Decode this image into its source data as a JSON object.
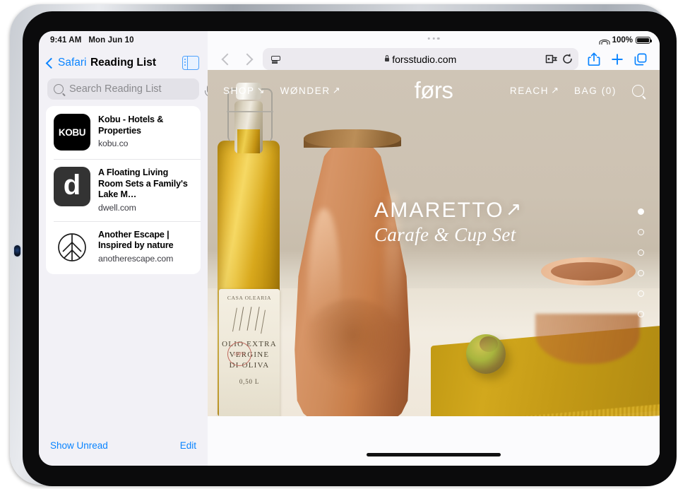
{
  "status_bar": {
    "time": "9:41 AM",
    "date": "Mon Jun 10",
    "battery_percent": "100%",
    "wifi_icon": "wifi-icon",
    "battery_icon": "battery-icon"
  },
  "sidebar": {
    "back_label": "Safari",
    "title": "Reading List",
    "toggle_icon": "sidebar-toggle-icon",
    "search": {
      "placeholder": "Search Reading List",
      "value": "",
      "search_icon": "search-icon",
      "mic_icon": "microphone-icon"
    },
    "items": [
      {
        "title": "Kobu - Hotels & Properties",
        "host": "kobu.co",
        "icon_label": "KOBU",
        "icon_name": "kobu-favicon"
      },
      {
        "title": "A Floating Living Room Sets a Family's Lake M…",
        "host": "dwell.com",
        "icon_label": "d",
        "icon_name": "dwell-favicon"
      },
      {
        "title": "Another Escape | Inspired by nature",
        "host": "anotherescape.com",
        "icon_label": "",
        "icon_name": "leaf-favicon"
      }
    ],
    "footer": {
      "show_unread": "Show Unread",
      "edit": "Edit"
    }
  },
  "browser": {
    "back_icon": "chevron-left-icon",
    "forward_icon": "chevron-forward-icon",
    "page_settings_icon": "page-settings-icon",
    "lock_icon": "lock-icon",
    "url": "forsstudio.com",
    "extensions_icon": "extensions-icon",
    "reload_icon": "reload-icon",
    "share_icon": "share-icon",
    "new_tab_icon": "plus-icon",
    "tabs_icon": "tab-overview-icon",
    "window_dots_icon": "multitask-dots-icon"
  },
  "site": {
    "brand": "førs",
    "nav_left": [
      {
        "label": "SHOP",
        "arrow": "↘"
      },
      {
        "label": "WØNDER",
        "arrow": "↗"
      }
    ],
    "nav_right": [
      {
        "label": "REACH",
        "arrow": "↗"
      },
      {
        "label": "BAG (0)",
        "arrow": ""
      }
    ],
    "search_icon": "search-icon",
    "hero": {
      "title": "AMARETTO",
      "title_arrow": "↗",
      "subtitle": "Carafe & Cup Set"
    },
    "pagination": {
      "total": 6,
      "active_index": 0
    },
    "colors": {
      "accent_blue": "#0a84ff",
      "hero_bg": "#c9bdac",
      "carafe": "#cf8b5a",
      "cloth": "#c59b16"
    }
  },
  "home_indicator": "home-indicator"
}
